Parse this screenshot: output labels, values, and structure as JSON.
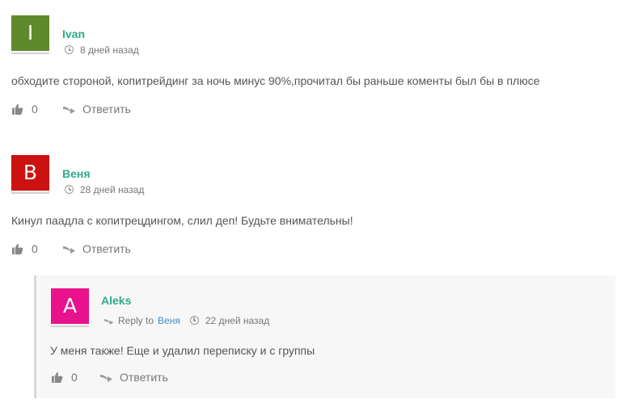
{
  "comments": [
    {
      "avatar_letter": "I",
      "avatar_color": "#5e8a2b",
      "author": "Ivan",
      "time": "8 дней назад",
      "text": "обходите стороной, копитрейдинг за ночь минус 90%,прочитал бы раньше коменты был бы в плюсе",
      "likes": "0",
      "reply_label": "Ответить"
    },
    {
      "avatar_letter": "В",
      "avatar_color": "#cc1111",
      "author": "Веня",
      "time": "28 дней назад",
      "text": "Кинул паадла с копитрецдингом, слил деп! Будьте внимательны!",
      "likes": "0",
      "reply_label": "Ответить"
    }
  ],
  "reply": {
    "avatar_letter": "A",
    "avatar_color": "#e8138c",
    "author": "Aleks",
    "reply_to_label": "Reply to",
    "reply_to_name": "Веня",
    "time": "22 дней назад",
    "text": "У меня также! Еще и удалил переписку и с группы",
    "likes": "0",
    "reply_label": "Ответить"
  }
}
